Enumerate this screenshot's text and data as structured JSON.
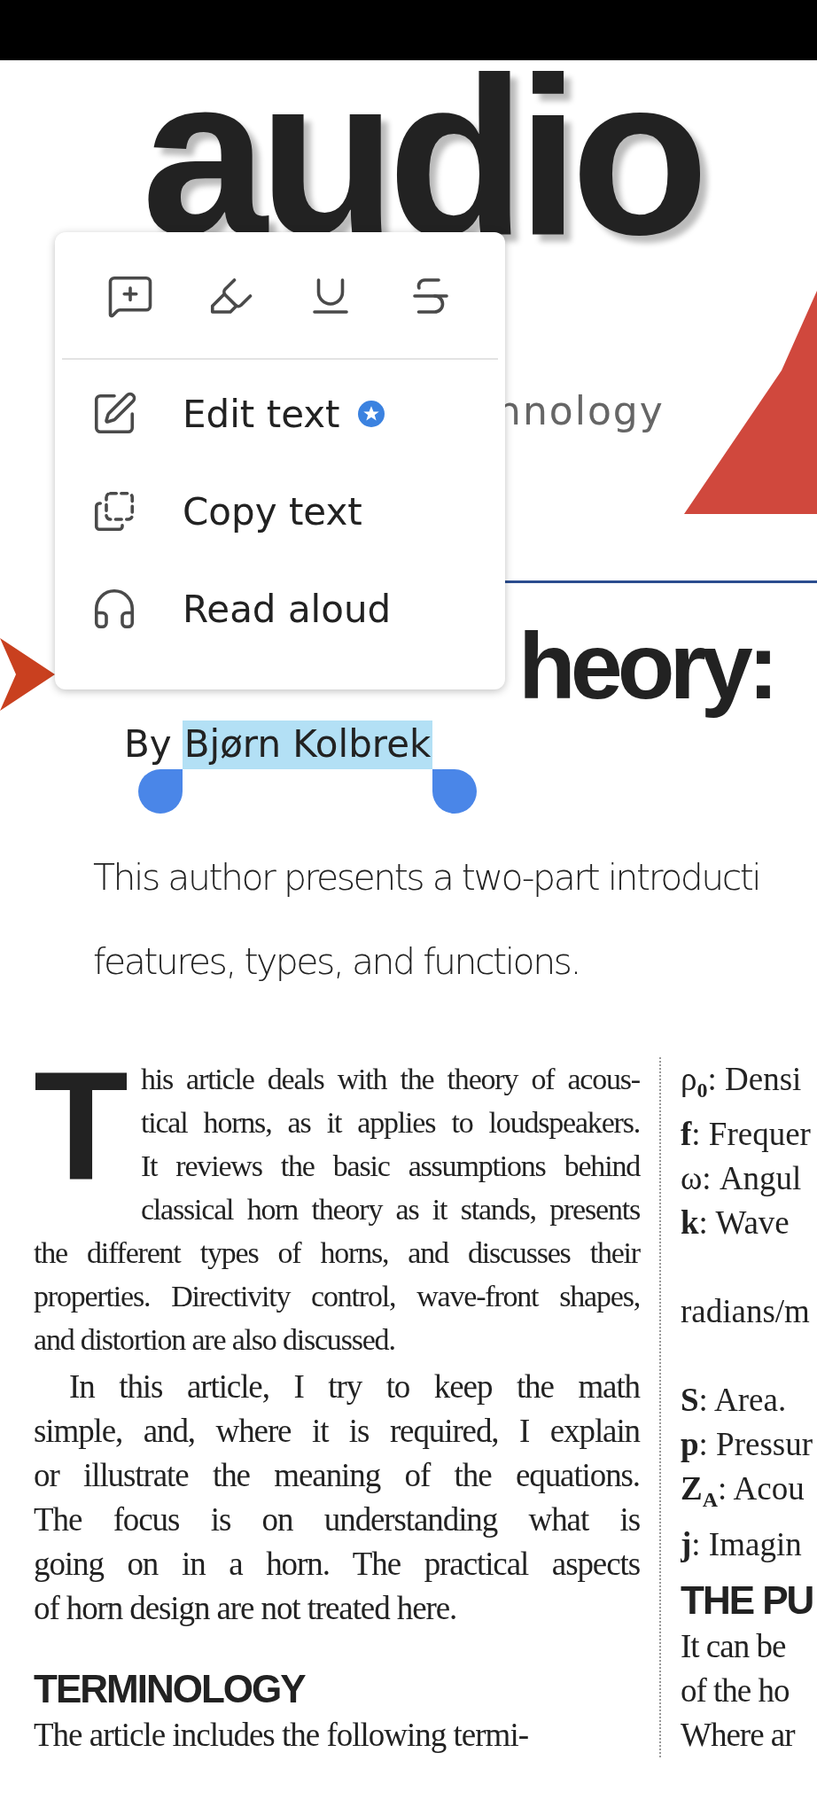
{
  "masthead": {
    "wordmark": "audio",
    "tagline": "nnology"
  },
  "context_menu": {
    "tools": [
      {
        "kind": "comment"
      },
      {
        "kind": "highlight"
      },
      {
        "kind": "underline"
      },
      {
        "kind": "strikethrough"
      }
    ],
    "items": [
      {
        "kind": "edit",
        "label": "Edit text",
        "badge": true
      },
      {
        "kind": "copy",
        "label": "Copy text",
        "badge": false
      },
      {
        "kind": "read",
        "label": "Read aloud",
        "badge": false
      }
    ]
  },
  "article": {
    "title": "heory:",
    "byline": {
      "prefix": "By",
      "author": "Bjørn Kolbrek",
      "selected": true
    },
    "intro_lines": [
      "This author presents a two-part introducti",
      "features, types, and functions."
    ],
    "left_column": {
      "drop_cap": "T",
      "beside_cap": [
        "his article deals with the theory of acous-",
        "tical horns, as it applies to loudspeakers.",
        "It reviews the basic assumptions behind",
        "classical horn theory as it stands, presents"
      ],
      "paragraphs": [
        {
          "indent": false,
          "lines": [
            "the different types of horns, and discusses their",
            "properties. Directivity control, wave-front shapes,",
            "and distortion are also discussed."
          ]
        },
        {
          "indent": true,
          "lines": [
            "In this article, I try to keep the math",
            "simple, and, where it is required, I explain",
            "or illustrate the meaning of the equations.",
            "The focus is on understanding what is",
            "going on in a horn. The practical aspects",
            "of horn design are not treated here."
          ]
        }
      ],
      "heading": "TERMINOLOGY",
      "after_heading": "The article includes the following termi-"
    },
    "right_column": {
      "terms": [
        {
          "text": "ρ$_{0}$: Densi"
        },
        {
          "text": "**f**: Frequer"
        },
        {
          "text": "ω: Angul"
        },
        {
          "text": "**k**:  Wave"
        },
        {
          "text": "radians/m",
          "gap_before": true
        },
        {
          "text": "**S**: Area.",
          "gap_before": true
        },
        {
          "text": "**p**: Pressur"
        },
        {
          "text": "**Z**$_{A}$: Acou"
        },
        {
          "text": "**j**: Imagin"
        }
      ],
      "heading": "THE PU",
      "lines": [
        "It can be",
        "of the ho",
        "Where ar"
      ]
    }
  }
}
